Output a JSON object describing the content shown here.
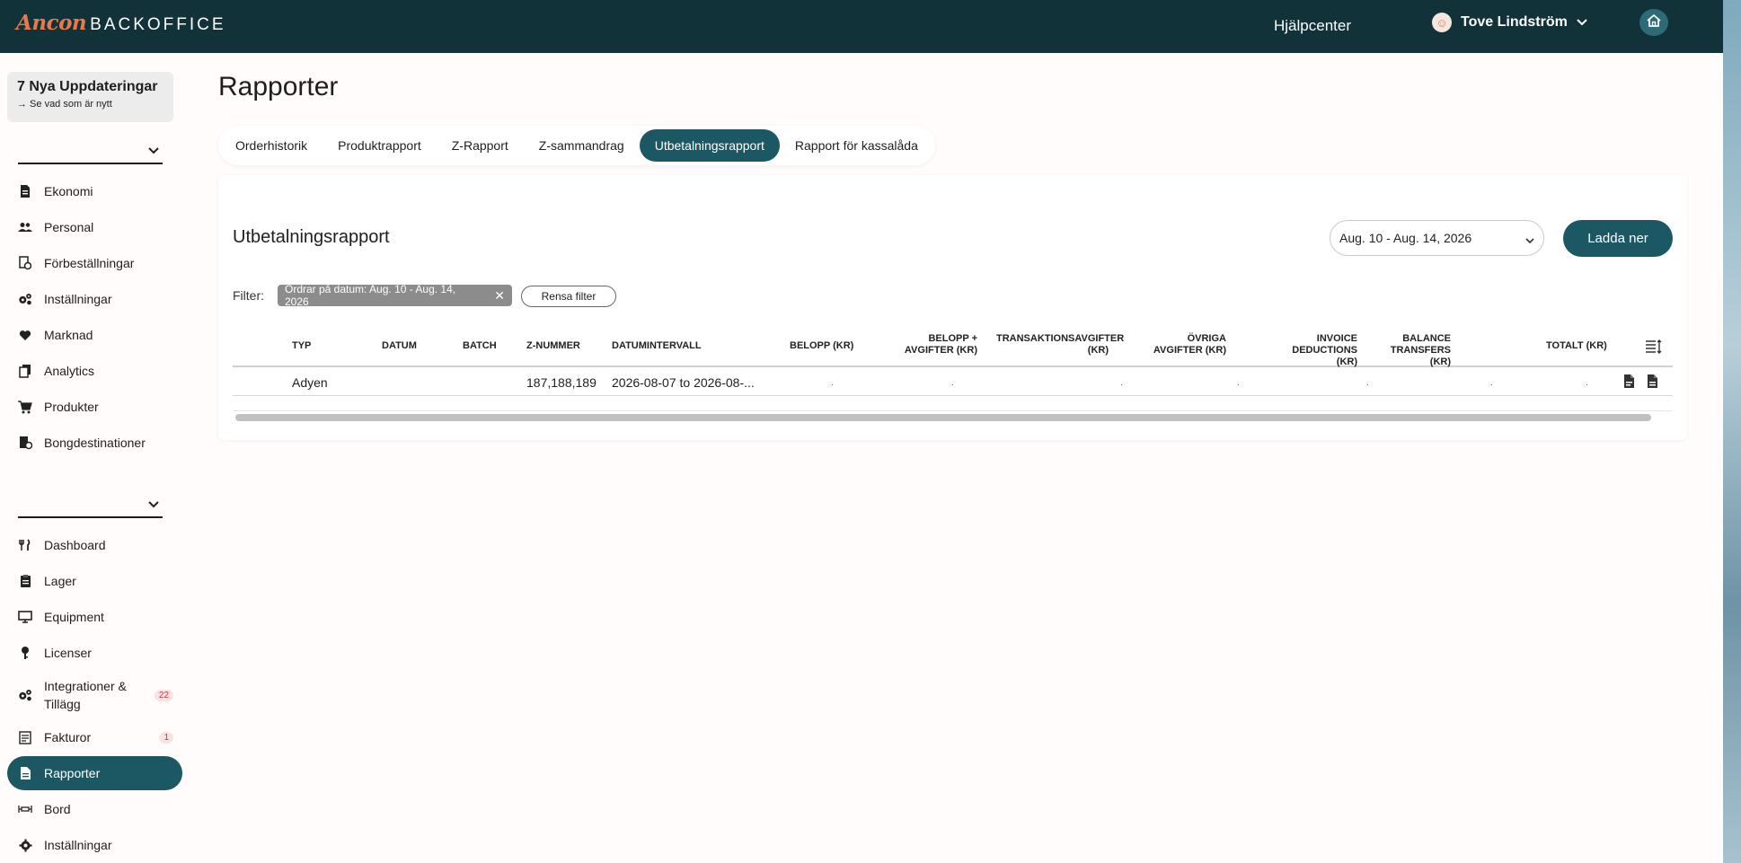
{
  "topbar": {
    "brand": "Ancon",
    "product": "BACKOFFICE",
    "help": "Hjälpcenter",
    "user_name": "Tove Lindström"
  },
  "sidebar": {
    "updates_title": "7 Nya Uppdateringar",
    "updates_sub": "→ Se vad som är nytt",
    "group1": [
      {
        "label": "Ekonomi",
        "icon": "document-icon"
      },
      {
        "label": "Personal",
        "icon": "people-icon"
      },
      {
        "label": "Förbeställningar",
        "icon": "preorder-icon"
      },
      {
        "label": "Inställningar",
        "icon": "gears-icon"
      },
      {
        "label": "Marknad",
        "icon": "heart-icon"
      },
      {
        "label": "Analytics",
        "icon": "pages-icon"
      },
      {
        "label": "Produkter",
        "icon": "cart-icon"
      },
      {
        "label": "Bongdestinationer",
        "icon": "printer-settings-icon"
      }
    ],
    "group2": [
      {
        "label": "Dashboard",
        "icon": "cutlery-icon"
      },
      {
        "label": "Lager",
        "icon": "clipboard-icon"
      },
      {
        "label": "Equipment",
        "icon": "monitor-icon"
      },
      {
        "label": "Licenser",
        "icon": "key-icon"
      },
      {
        "label": "Integrationer & Tillägg",
        "icon": "gears-icon",
        "badge": "22"
      },
      {
        "label": "Fakturor",
        "icon": "invoice-icon",
        "badge": "1"
      },
      {
        "label": "Rapporter",
        "icon": "report-icon",
        "active": true
      },
      {
        "label": "Bord",
        "icon": "table-icon"
      },
      {
        "label": "Inställningar",
        "icon": "gear-icon"
      }
    ]
  },
  "main": {
    "page_title": "Rapporter",
    "tabs": [
      "Orderhistorik",
      "Produktrapport",
      "Z-Rapport",
      "Z-sammandrag",
      "Utbetalningsrapport",
      "Rapport för kassalåda"
    ],
    "active_tab": 4,
    "card_title": "Utbetalningsrapport",
    "date_range": "Aug. 10 - Aug. 14, 2026",
    "download_label": "Ladda ner",
    "filter_label": "Filter:",
    "filter_chip": "Ordrar på datum: Aug. 10 - Aug. 14, 2026",
    "clear_filter": "Rensa filter"
  },
  "table": {
    "headers": [
      "TYP",
      "DATUM",
      "BATCH",
      "Z-NUMMER",
      "DATUMINTERVALL",
      "BELOPP (KR)",
      "BELOPP + AVGIFTER (KR)",
      "TRANSAKTIONSAVGIFTER (KR)",
      "ÖVRIGA AVGIFTER (KR)",
      "INVOICE DEDUCTIONS (KR)",
      "BALANCE TRANSFERS (KR)",
      "TOTALT (KR)"
    ],
    "rows": [
      {
        "typ": "Adyen",
        "datum": "",
        "batch": "",
        "znummer": "187,188,189",
        "intervall": "2026-08-07 to 2026-08-..."
      }
    ]
  },
  "colors": {
    "topbar": "#103238",
    "accent": "#1c5863",
    "brand": "#e8794a"
  }
}
